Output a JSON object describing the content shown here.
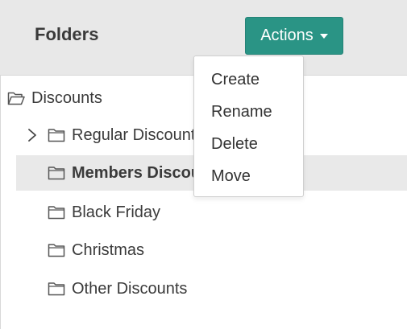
{
  "header": {
    "title": "Folders",
    "actions_label": "Actions"
  },
  "actions_menu": {
    "items": [
      {
        "label": "Create"
      },
      {
        "label": "Rename"
      },
      {
        "label": "Delete"
      },
      {
        "label": "Move"
      }
    ]
  },
  "tree": {
    "root": {
      "label": "Discounts",
      "icon": "folder-open-icon"
    },
    "children": [
      {
        "label": "Regular Discounts",
        "icon": "folder-icon",
        "expandable": true,
        "selected": false
      },
      {
        "label": "Members Discounts",
        "icon": "folder-icon",
        "expandable": false,
        "selected": true
      },
      {
        "label": "Black Friday",
        "icon": "folder-icon",
        "expandable": false,
        "selected": false
      },
      {
        "label": "Christmas",
        "icon": "folder-icon",
        "expandable": false,
        "selected": false
      },
      {
        "label": "Other Discounts",
        "icon": "folder-icon",
        "expandable": false,
        "selected": false
      }
    ]
  },
  "colors": {
    "accent": "#2a9485",
    "header_bg": "#e8e8e8",
    "selected_bg": "#e9e9e9"
  }
}
